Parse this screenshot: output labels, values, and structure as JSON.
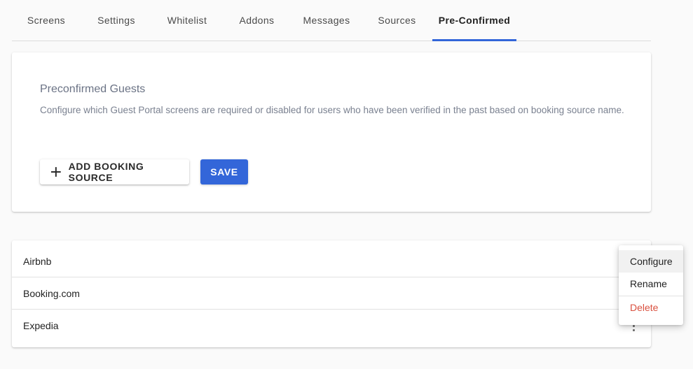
{
  "tabs": [
    {
      "label": "Screens"
    },
    {
      "label": "Settings"
    },
    {
      "label": "Whitelist"
    },
    {
      "label": "Addons"
    },
    {
      "label": "Messages"
    },
    {
      "label": "Sources"
    },
    {
      "label": "Pre-Confirmed",
      "active": true
    }
  ],
  "card": {
    "title": "Preconfirmed Guests",
    "description": "Configure which Guest Portal screens are required or disabled for users who have been verified in the past based on booking source name.",
    "add_button_label": "ADD BOOKING SOURCE",
    "add_button_icon": "plus-icon",
    "save_button_label": "SAVE"
  },
  "sources": [
    {
      "name": "Airbnb"
    },
    {
      "name": "Booking.com"
    },
    {
      "name": "Expedia"
    }
  ],
  "menu": {
    "items": [
      {
        "label": "Configure"
      },
      {
        "label": "Rename"
      },
      {
        "label": "Delete"
      }
    ]
  },
  "colors": {
    "accent": "#3366d9",
    "danger": "#d9503f",
    "background": "#fafafa"
  }
}
